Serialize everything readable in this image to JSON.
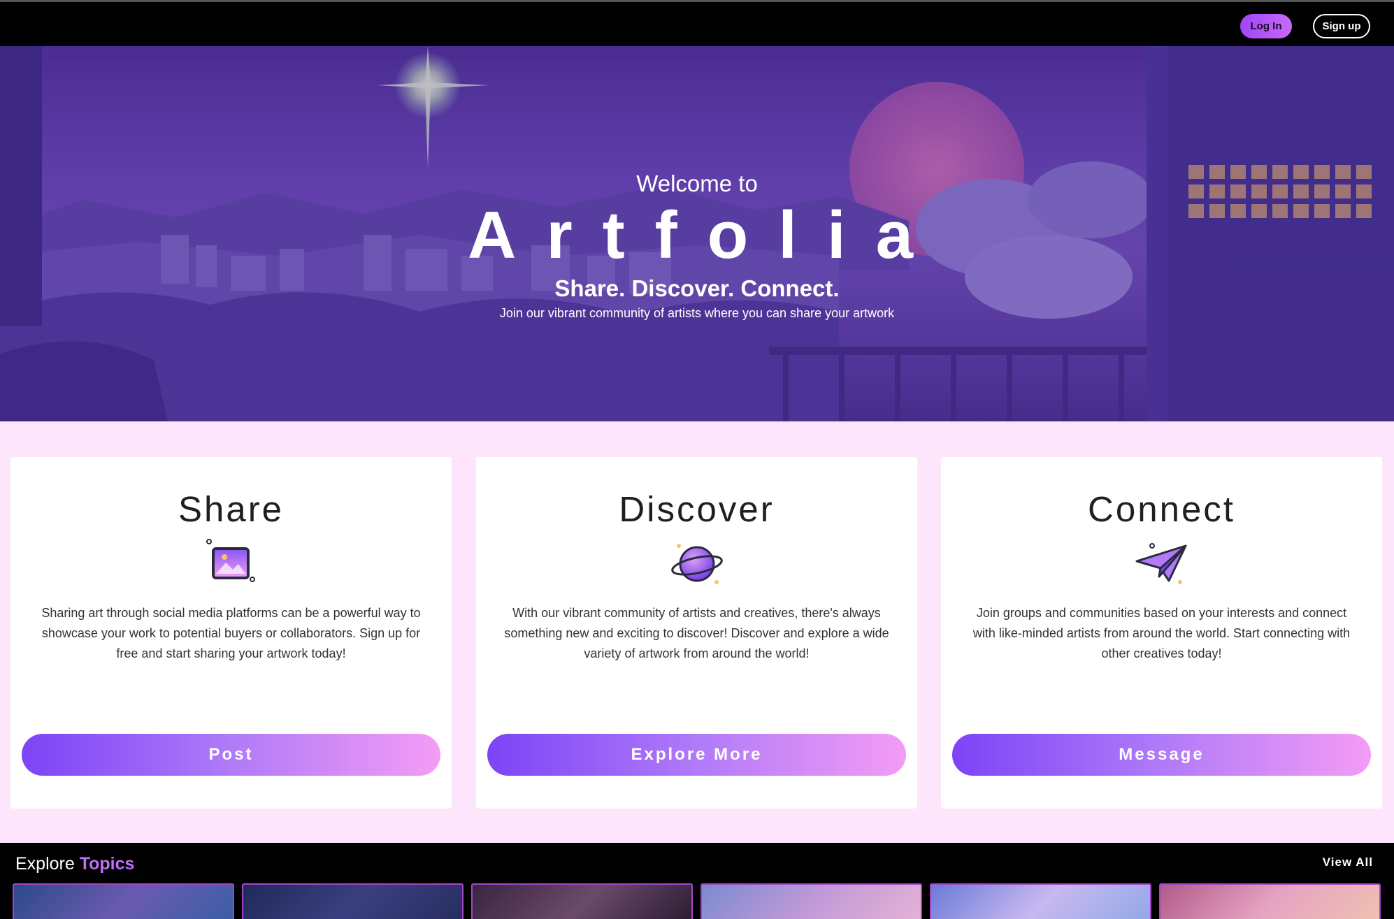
{
  "nav": {
    "login_label": "Log In",
    "signup_label": "Sign up"
  },
  "hero": {
    "welcome": "Welcome to",
    "brand": "Artfolia",
    "tagline": "Share. Discover. Connect.",
    "subtext": "Join our vibrant community of artists where you can share your artwork"
  },
  "cards": [
    {
      "title": "Share",
      "icon": "image-upload-icon",
      "text": "Sharing art through social media platforms can be a powerful way to showcase your work to potential buyers or collaborators. Sign up for free and start sharing your artwork today!",
      "button": "Post"
    },
    {
      "title": "Discover",
      "icon": "planet-icon",
      "text": "With our vibrant community of artists and creatives, there's always something new and exciting to discover! Discover and explore a wide variety of artwork from around the world!",
      "button": "Explore More"
    },
    {
      "title": "Connect",
      "icon": "paper-plane-icon",
      "text": "Join groups and communities based on your interests and connect with like-minded artists from around the world. Start connecting with other creatives today!",
      "button": "Message"
    }
  ],
  "explore": {
    "title_prefix": "Explore",
    "title_accent": "Topics",
    "view_all": "View All"
  },
  "colors": {
    "accent": "#a145f5",
    "feature_bg": "#fde6fb",
    "button_from": "#7c44f6",
    "button_to": "#f49cf5"
  }
}
